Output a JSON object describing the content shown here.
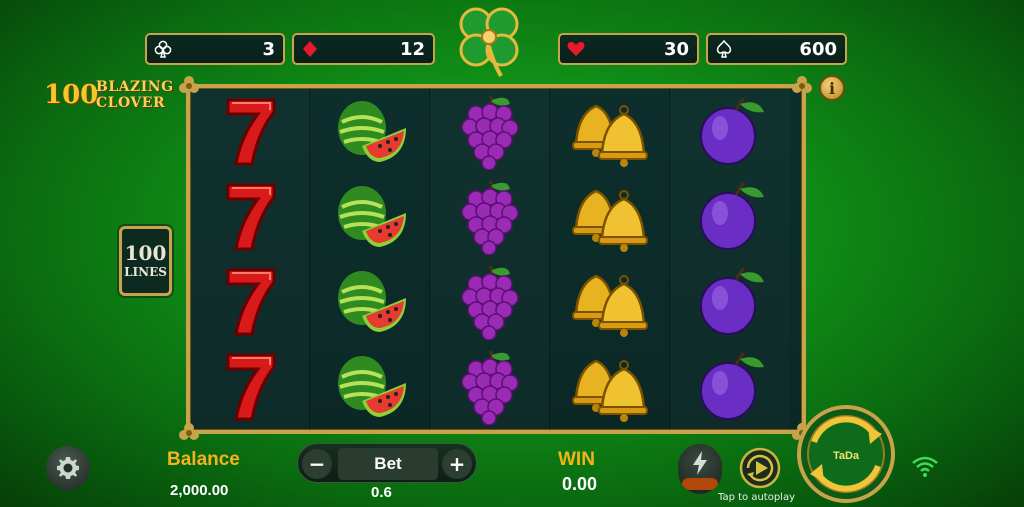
{
  "game": {
    "logo": {
      "number": "100",
      "line1": "BLAZING",
      "line2": "CLOVER"
    },
    "lines": {
      "number": "100",
      "text": "LINES"
    },
    "info_label": "i"
  },
  "jackpots": [
    {
      "suit": "club-icon",
      "value": "3"
    },
    {
      "suit": "diamond-icon",
      "value": "12"
    },
    {
      "suit": "heart-icon",
      "value": "30"
    },
    {
      "suit": "spade-icon",
      "value": "600"
    }
  ],
  "reels": [
    [
      "seven",
      "seven",
      "seven",
      "seven"
    ],
    [
      "watermelon",
      "watermelon",
      "watermelon",
      "watermelon"
    ],
    [
      "grapes",
      "grapes",
      "grapes",
      "grapes"
    ],
    [
      "bells",
      "bells",
      "bells",
      "bells"
    ],
    [
      "plum",
      "plum",
      "plum",
      "plum"
    ]
  ],
  "bottom": {
    "balance_label": "Balance",
    "balance_value": "2,000.00",
    "bet_label": "Bet",
    "bet_minus": "−",
    "bet_plus": "+",
    "bet_value": "0.6",
    "win_label": "WIN",
    "win_value": "0.00",
    "autoplay_label": "Tap to autoplay",
    "spin_label": "TaDa"
  },
  "colors": {
    "gold": "#c9a34a",
    "balance_label": "#f3b41b",
    "background": "#119217",
    "reel_bg": "#0d2f2c"
  }
}
